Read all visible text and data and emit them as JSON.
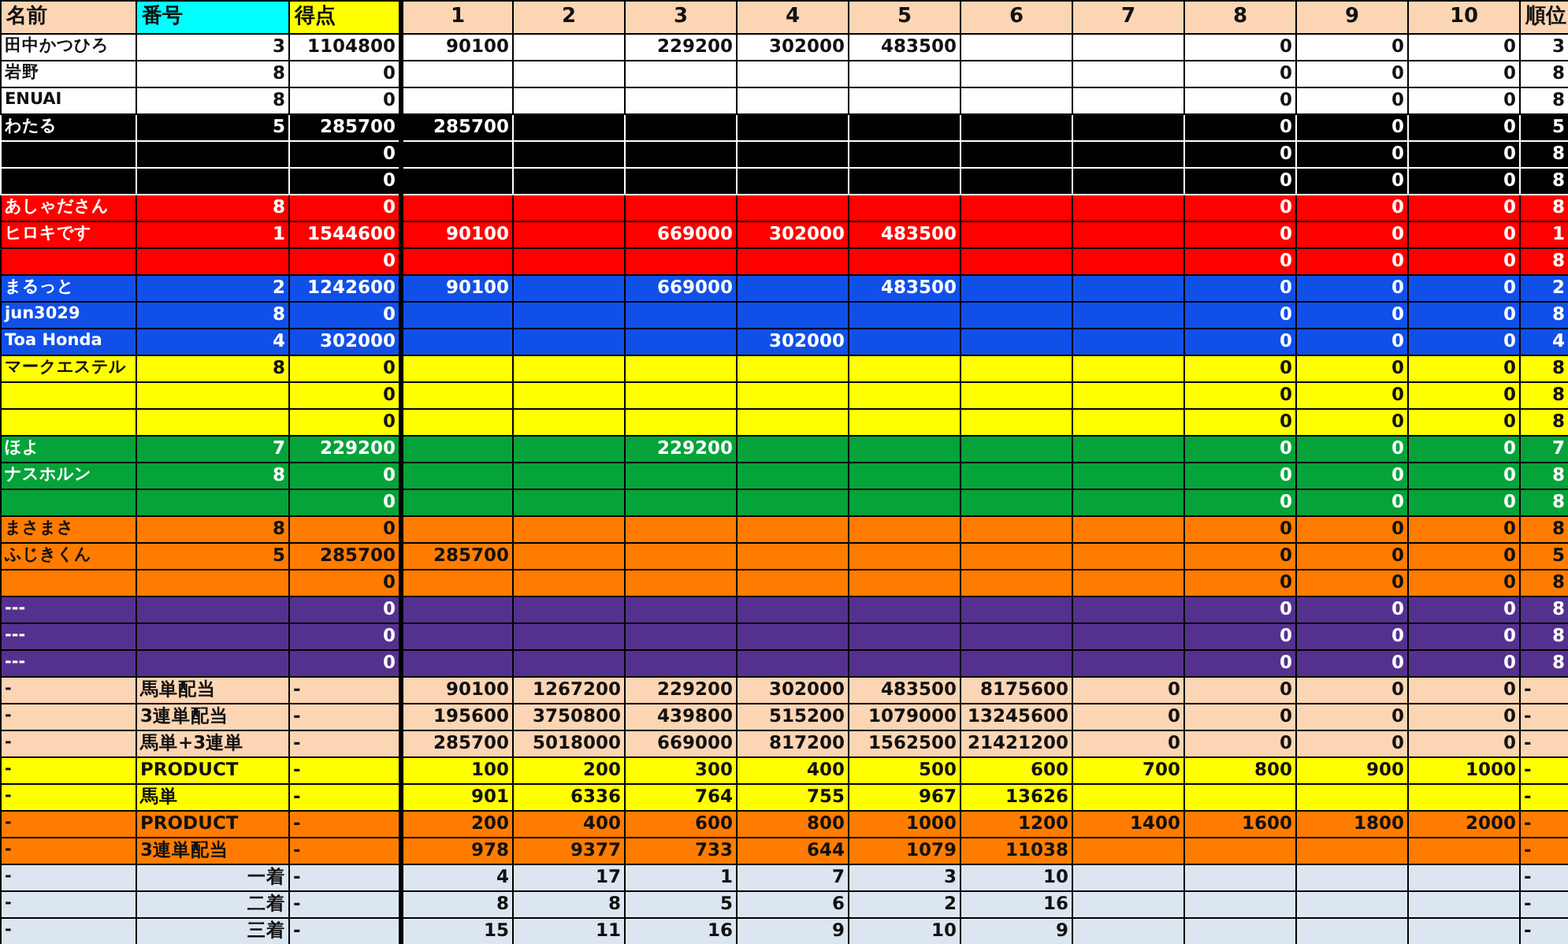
{
  "table": {
    "columns": [
      {
        "label": "名前",
        "color": "#fcd5b4"
      },
      {
        "label": "番号",
        "color": "#00ffff"
      },
      {
        "label": "得点",
        "color": "#ffff00"
      },
      {
        "label": "1",
        "color": "#fcd5b4"
      },
      {
        "label": "2",
        "color": "#fcd5b4"
      },
      {
        "label": "3",
        "color": "#fcd5b4"
      },
      {
        "label": "4",
        "color": "#fcd5b4"
      },
      {
        "label": "5",
        "color": "#fcd5b4"
      },
      {
        "label": "6",
        "color": "#fcd5b4"
      },
      {
        "label": "7",
        "color": "#fcd5b4"
      },
      {
        "label": "8",
        "color": "#fcd5b4"
      },
      {
        "label": "9",
        "color": "#fcd5b4"
      },
      {
        "label": "10",
        "color": "#fcd5b4"
      },
      {
        "label": "順位",
        "color": "#fcd5b4"
      }
    ],
    "rows": [
      {
        "kind": "player",
        "color": "#ffffff",
        "cells": [
          "田中かつひろ",
          "3",
          "1104800",
          "90100",
          null,
          "229200",
          "302000",
          "483500",
          null,
          null,
          "0",
          "0",
          "0",
          "3"
        ]
      },
      {
        "kind": "player",
        "color": "#ffffff",
        "cells": [
          "岩野",
          "8",
          "0",
          null,
          null,
          null,
          null,
          null,
          null,
          null,
          "0",
          "0",
          "0",
          "8"
        ]
      },
      {
        "kind": "player",
        "color": "#ffffff",
        "cells": [
          "ENUAI",
          "8",
          "0",
          null,
          null,
          null,
          null,
          null,
          null,
          null,
          "0",
          "0",
          "0",
          "8"
        ]
      },
      {
        "kind": "player",
        "color": "#000000",
        "cells": [
          "わたる",
          "5",
          "285700",
          "285700",
          null,
          null,
          null,
          null,
          null,
          null,
          "0",
          "0",
          "0",
          "5"
        ]
      },
      {
        "kind": "player",
        "color": "#000000",
        "cells": [
          null,
          null,
          "0",
          null,
          null,
          null,
          null,
          null,
          null,
          null,
          "0",
          "0",
          "0",
          "8"
        ]
      },
      {
        "kind": "player",
        "color": "#000000",
        "cells": [
          null,
          null,
          "0",
          null,
          null,
          null,
          null,
          null,
          null,
          null,
          "0",
          "0",
          "0",
          "8"
        ]
      },
      {
        "kind": "player",
        "color": "#ff0000",
        "cells": [
          "あしゃださん",
          "8",
          "0",
          null,
          null,
          null,
          null,
          null,
          null,
          null,
          "0",
          "0",
          "0",
          "8"
        ]
      },
      {
        "kind": "player",
        "color": "#ff0000",
        "cells": [
          "ヒロキです",
          "1",
          "1544600",
          "90100",
          null,
          "669000",
          "302000",
          "483500",
          null,
          null,
          "0",
          "0",
          "0",
          "1"
        ]
      },
      {
        "kind": "player",
        "color": "#ff0000",
        "cells": [
          null,
          null,
          "0",
          null,
          null,
          null,
          null,
          null,
          null,
          null,
          "0",
          "0",
          "0",
          "8"
        ]
      },
      {
        "kind": "player",
        "color": "#1150e8",
        "cells": [
          "まるっと",
          "2",
          "1242600",
          "90100",
          null,
          "669000",
          null,
          "483500",
          null,
          null,
          "0",
          "0",
          "0",
          "2"
        ]
      },
      {
        "kind": "player",
        "color": "#1150e8",
        "cells": [
          "jun3029",
          "8",
          "0",
          null,
          null,
          null,
          null,
          null,
          null,
          null,
          "0",
          "0",
          "0",
          "8"
        ]
      },
      {
        "kind": "player",
        "color": "#1150e8",
        "cells": [
          "Toa Honda",
          "4",
          "302000",
          null,
          null,
          null,
          "302000",
          null,
          null,
          null,
          "0",
          "0",
          "0",
          "4"
        ]
      },
      {
        "kind": "player",
        "color": "#ffff00",
        "cells": [
          "マークエステル",
          "8",
          "0",
          null,
          null,
          null,
          null,
          null,
          null,
          null,
          "0",
          "0",
          "0",
          "8"
        ]
      },
      {
        "kind": "player",
        "color": "#ffff00",
        "cells": [
          null,
          null,
          "0",
          null,
          null,
          null,
          null,
          null,
          null,
          null,
          "0",
          "0",
          "0",
          "8"
        ]
      },
      {
        "kind": "player",
        "color": "#ffff00",
        "cells": [
          null,
          null,
          "0",
          null,
          null,
          null,
          null,
          null,
          null,
          null,
          "0",
          "0",
          "0",
          "8"
        ]
      },
      {
        "kind": "player",
        "color": "#05a33a",
        "cells": [
          "ほよ",
          "7",
          "229200",
          null,
          null,
          "229200",
          null,
          null,
          null,
          null,
          "0",
          "0",
          "0",
          "7"
        ]
      },
      {
        "kind": "player",
        "color": "#05a33a",
        "cells": [
          "ナスホルン",
          "8",
          "0",
          null,
          null,
          null,
          null,
          null,
          null,
          null,
          "0",
          "0",
          "0",
          "8"
        ]
      },
      {
        "kind": "player",
        "color": "#05a33a",
        "cells": [
          null,
          null,
          "0",
          null,
          null,
          null,
          null,
          null,
          null,
          null,
          "0",
          "0",
          "0",
          "8"
        ]
      },
      {
        "kind": "player",
        "color": "#ff7c00",
        "cells": [
          "まさまさ",
          "8",
          "0",
          null,
          null,
          null,
          null,
          null,
          null,
          null,
          "0",
          "0",
          "0",
          "8"
        ]
      },
      {
        "kind": "player",
        "color": "#ff7c00",
        "cells": [
          "ふじきくん",
          "5",
          "285700",
          "285700",
          null,
          null,
          null,
          null,
          null,
          null,
          "0",
          "0",
          "0",
          "5"
        ]
      },
      {
        "kind": "player",
        "color": "#ff7c00",
        "cells": [
          null,
          null,
          "0",
          null,
          null,
          null,
          null,
          null,
          null,
          null,
          "0",
          "0",
          "0",
          "8"
        ]
      },
      {
        "kind": "player",
        "color": "#55318f",
        "cells": [
          "---",
          null,
          "0",
          null,
          null,
          null,
          null,
          null,
          null,
          null,
          "0",
          "0",
          "0",
          "8"
        ]
      },
      {
        "kind": "player",
        "color": "#55318f",
        "cells": [
          "---",
          null,
          "0",
          null,
          null,
          null,
          null,
          null,
          null,
          null,
          "0",
          "0",
          "0",
          "8"
        ]
      },
      {
        "kind": "player",
        "color": "#55318f",
        "cells": [
          "---",
          null,
          "0",
          null,
          null,
          null,
          null,
          null,
          null,
          null,
          "0",
          "0",
          "0",
          "8"
        ]
      },
      {
        "kind": "summary",
        "color": "#fcd5b4",
        "cells": [
          "-",
          "馬単配当",
          "-",
          "90100",
          "1267200",
          "229200",
          "302000",
          "483500",
          "8175600",
          "0",
          "0",
          "0",
          "0",
          "-"
        ]
      },
      {
        "kind": "summary",
        "color": "#fcd5b4",
        "cells": [
          "-",
          "3連単配当",
          "-",
          "195600",
          "3750800",
          "439800",
          "515200",
          "1079000",
          "13245600",
          "0",
          "0",
          "0",
          "0",
          "-"
        ]
      },
      {
        "kind": "summary",
        "color": "#fcd5b4",
        "cells": [
          "-",
          "馬単+3連単",
          "-",
          "285700",
          "5018000",
          "669000",
          "817200",
          "1562500",
          "21421200",
          "0",
          "0",
          "0",
          "0",
          "-"
        ]
      },
      {
        "kind": "summary",
        "color": "#ffff00",
        "cells": [
          "-",
          "PRODUCT",
          "-",
          "100",
          "200",
          "300",
          "400",
          "500",
          "600",
          "700",
          "800",
          "900",
          "1000",
          "-"
        ]
      },
      {
        "kind": "summary",
        "color": "#ffff00",
        "cells": [
          "-",
          "馬単",
          "-",
          "901",
          "6336",
          "764",
          "755",
          "967",
          "13626",
          null,
          null,
          null,
          null,
          "-"
        ]
      },
      {
        "kind": "summary",
        "color": "#ff7c00",
        "cells": [
          "-",
          "PRODUCT",
          "-",
          "200",
          "400",
          "600",
          "800",
          "1000",
          "1200",
          "1400",
          "1600",
          "1800",
          "2000",
          "-"
        ]
      },
      {
        "kind": "summary",
        "color": "#ff7c00",
        "cells": [
          "-",
          "3連単配当",
          "-",
          "978",
          "9377",
          "733",
          "644",
          "1079",
          "11038",
          null,
          null,
          null,
          null,
          "-"
        ]
      },
      {
        "kind": "placing",
        "color": "#dce6f0",
        "cells": [
          "-",
          "一着",
          "-",
          "4",
          "17",
          "1",
          "7",
          "3",
          "10",
          null,
          null,
          null,
          null,
          "-"
        ]
      },
      {
        "kind": "placing",
        "color": "#dce6f0",
        "cells": [
          "-",
          "二着",
          "-",
          "8",
          "8",
          "5",
          "6",
          "2",
          "16",
          null,
          null,
          null,
          null,
          "-"
        ]
      },
      {
        "kind": "placing",
        "color": "#dce6f0",
        "cells": [
          "-",
          "三着",
          "-",
          "15",
          "11",
          "16",
          "9",
          "10",
          "9",
          null,
          null,
          null,
          null,
          "-"
        ]
      }
    ]
  }
}
